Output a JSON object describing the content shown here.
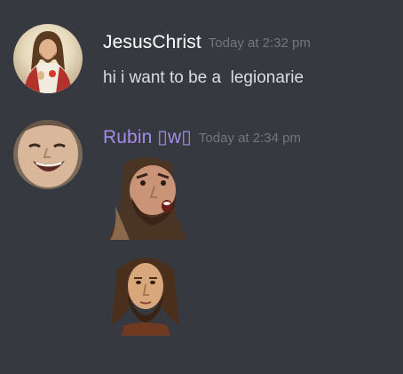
{
  "messages": [
    {
      "author": "JesusChrist",
      "author_color": "#ffffff",
      "timestamp": "Today at 2:32 pm",
      "text": "hi i want to be a  legionarie"
    },
    {
      "author": "Rubin ▯w▯",
      "author_color": "#a48ce6",
      "timestamp": "Today at 2:34 pm",
      "emotes": [
        "shocked-bearded-man-emote",
        "jesus-face-emote"
      ]
    }
  ],
  "theme": {
    "background": "#36393f",
    "text": "#dcddde",
    "muted": "#72767d"
  }
}
